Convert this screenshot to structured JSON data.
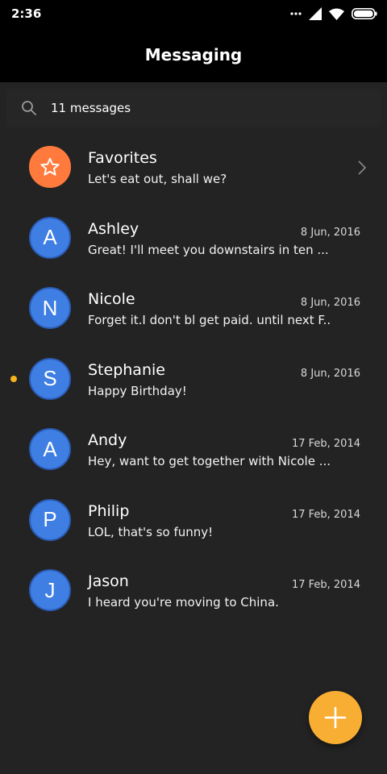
{
  "status_bar": {
    "time": "2:36",
    "icons": [
      "more-dots-icon",
      "signal-icon",
      "wifi-icon",
      "battery-icon"
    ]
  },
  "header": {
    "title": "Messaging"
  },
  "search": {
    "icon": "search-icon",
    "text": "11 messages"
  },
  "conversations": [
    {
      "name": "Favorites",
      "preview": "Let's eat out, shall we?",
      "date": "",
      "avatar": "star-icon",
      "avatar_color": "#ff7a3c",
      "has_chevron": true,
      "unread": false
    },
    {
      "name": "Ashley",
      "preview": "Great! I'll meet you downstairs in ten ...",
      "date": "8 Jun, 2016",
      "avatar": "A",
      "avatar_color": "#3f7ee3",
      "unread": false
    },
    {
      "name": "Nicole",
      "preview": "Forget it.I don't bl get paid. until next F...",
      "date": "8 Jun, 2016",
      "avatar": "N",
      "avatar_color": "#3f7ee3",
      "unread": false
    },
    {
      "name": "Stephanie",
      "preview": "Happy Birthday!",
      "date": "8 Jun, 2016",
      "avatar": "S",
      "avatar_color": "#3f7ee3",
      "unread": true
    },
    {
      "name": "Andy",
      "preview": "Hey, want to get together with Nicole ...",
      "date": "17 Feb, 2014",
      "avatar": "A",
      "avatar_color": "#3f7ee3",
      "unread": false
    },
    {
      "name": "Philip",
      "preview": "LOL, that's so funny!",
      "date": "17 Feb, 2014",
      "avatar": "P",
      "avatar_color": "#3f7ee3",
      "unread": false
    },
    {
      "name": "Jason",
      "preview": "I heard you're moving to China.",
      "date": "17 Feb, 2014",
      "avatar": "J",
      "avatar_color": "#3f7ee3",
      "unread": false
    }
  ],
  "fab": {
    "icon": "plus-icon",
    "color": "#f8ad33"
  },
  "colors": {
    "background": "#232323",
    "header": "#000000",
    "unread_dot": "#f5b41c"
  }
}
